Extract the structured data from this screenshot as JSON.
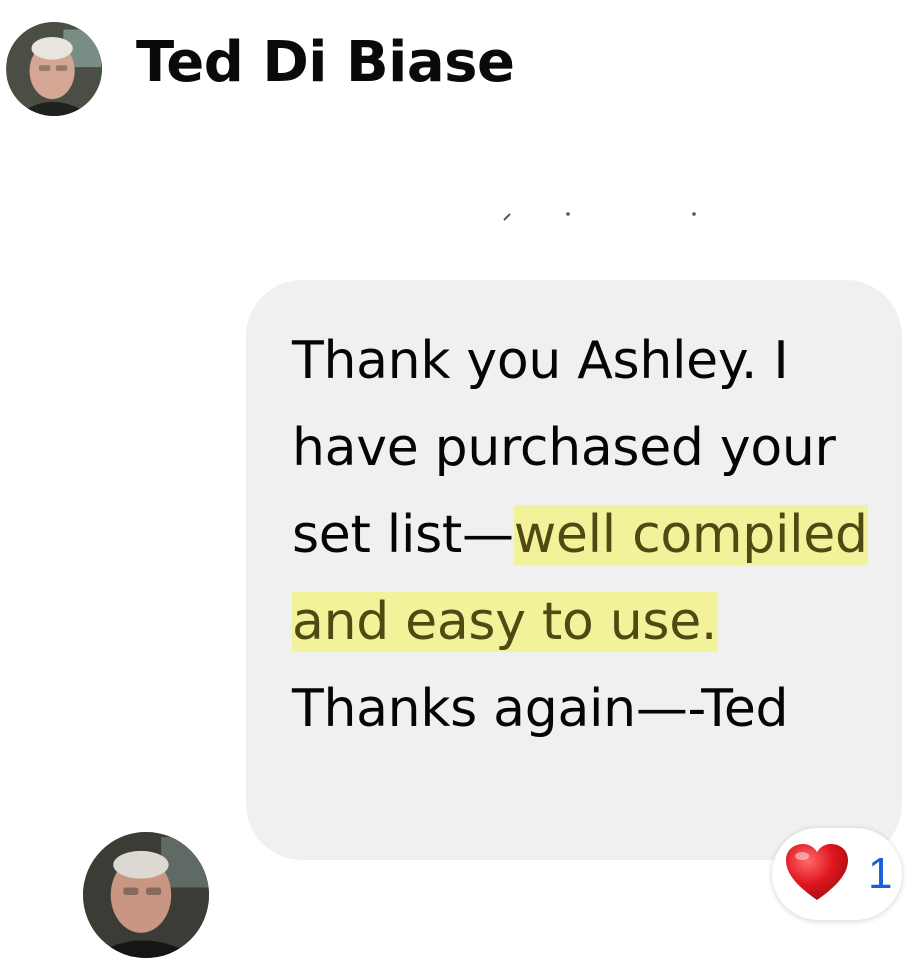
{
  "header": {
    "sender_name": "Ted Di Biase",
    "avatar_icon": "profile-photo"
  },
  "message": {
    "text_before_highlight": "Thank you Ashley. I have purchased your set list—",
    "text_highlighted": "well compiled and easy to use. ",
    "text_after_highlight": "Thanks again—-Ted",
    "highlight_color": "#f2f29a",
    "bubble_color": "#f0f0f0"
  },
  "reaction": {
    "icon": "red-heart-icon",
    "count": "1",
    "count_color": "#1a5fd8"
  },
  "bottom_avatar": {
    "icon": "profile-photo"
  }
}
